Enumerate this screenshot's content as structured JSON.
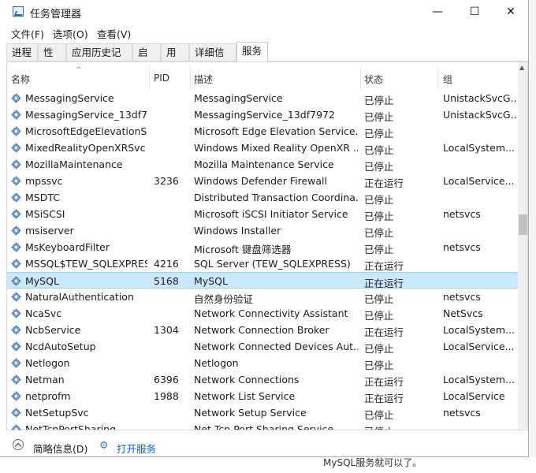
{
  "window": {
    "title": "任务管理器",
    "minimize": "—",
    "maximize": "☐",
    "close": "✕"
  },
  "menu": [
    "文件(F)",
    "选项(O)",
    "查看(V)"
  ],
  "tabs": [
    "进程",
    "性能",
    "应用历史记录",
    "启动",
    "用户",
    "详细信息",
    "服务"
  ],
  "active_tab": "服务",
  "table": {
    "columns": [
      "名称",
      "PID",
      "描述",
      "状态",
      "组"
    ],
    "rows": [
      {
        "name": "MessagingService",
        "pid": "",
        "desc": "MessagingService",
        "status": "已停止",
        "group": "UnistackSvcG..."
      },
      {
        "name": "MessagingService_13df7...",
        "pid": "",
        "desc": "MessagingService_13df7972",
        "status": "已停止",
        "group": "UnistackSvcG..."
      },
      {
        "name": "MicrosoftEdgeElevationS...",
        "pid": "",
        "desc": "Microsoft Edge Elevation Service...",
        "status": "已停止",
        "group": ""
      },
      {
        "name": "MixedRealityOpenXRSvc",
        "pid": "",
        "desc": "Windows Mixed Reality OpenXR ...",
        "status": "已停止",
        "group": "LocalSystem..."
      },
      {
        "name": "MozillaMaintenance",
        "pid": "",
        "desc": "Mozilla Maintenance Service",
        "status": "已停止",
        "group": ""
      },
      {
        "name": "mpssvc",
        "pid": "3236",
        "desc": "Windows Defender Firewall",
        "status": "正在运行",
        "group": "LocalService..."
      },
      {
        "name": "MSDTC",
        "pid": "",
        "desc": "Distributed Transaction Coordina...",
        "status": "已停止",
        "group": ""
      },
      {
        "name": "MSiSCSI",
        "pid": "",
        "desc": "Microsoft iSCSI Initiator Service",
        "status": "已停止",
        "group": "netsvcs"
      },
      {
        "name": "msiserver",
        "pid": "",
        "desc": "Windows Installer",
        "status": "已停止",
        "group": ""
      },
      {
        "name": "MsKeyboardFilter",
        "pid": "",
        "desc": "Microsoft 键盘筛选器",
        "status": "已停止",
        "group": "netsvcs"
      },
      {
        "name": "MSSQL$TEW_SQLEXPRESS",
        "pid": "4216",
        "desc": "SQL Server (TEW_SQLEXPRESS)",
        "status": "正在运行",
        "group": ""
      },
      {
        "name": "MySQL",
        "pid": "5168",
        "desc": "MySQL",
        "status": "正在运行",
        "group": ""
      },
      {
        "name": "NaturalAuthentication",
        "pid": "",
        "desc": "自然身份验证",
        "status": "已停止",
        "group": "netsvcs"
      },
      {
        "name": "NcaSvc",
        "pid": "",
        "desc": "Network Connectivity Assistant",
        "status": "已停止",
        "group": "NetSvcs"
      },
      {
        "name": "NcbService",
        "pid": "1304",
        "desc": "Network Connection Broker",
        "status": "正在运行",
        "group": "LocalSystem..."
      },
      {
        "name": "NcdAutoSetup",
        "pid": "",
        "desc": "Network Connected Devices Aut...",
        "status": "已停止",
        "group": "LocalService..."
      },
      {
        "name": "Netlogon",
        "pid": "",
        "desc": "Netlogon",
        "status": "已停止",
        "group": ""
      },
      {
        "name": "Netman",
        "pid": "6396",
        "desc": "Network Connections",
        "status": "正在运行",
        "group": "LocalSystem..."
      },
      {
        "name": "netprofm",
        "pid": "1988",
        "desc": "Network List Service",
        "status": "正在运行",
        "group": "LocalService"
      },
      {
        "name": "NetSetupSvc",
        "pid": "",
        "desc": "Network Setup Service",
        "status": "已停止",
        "group": "netsvcs"
      },
      {
        "name": "NetTcpPortSharing",
        "pid": "",
        "desc": "Net.Tcp Port Sharing Service",
        "status": "已停止",
        "group": ""
      }
    ],
    "selected_row": "MySQL"
  },
  "footer": {
    "details": "简略信息(D)",
    "open_services": "打开服务"
  },
  "background": {
    "bottom_text": "MySQL服务就可以了。"
  },
  "colors": {
    "selection": "#cce8ff",
    "selection_border": "#99d1ff",
    "link": "#0b63c1"
  }
}
